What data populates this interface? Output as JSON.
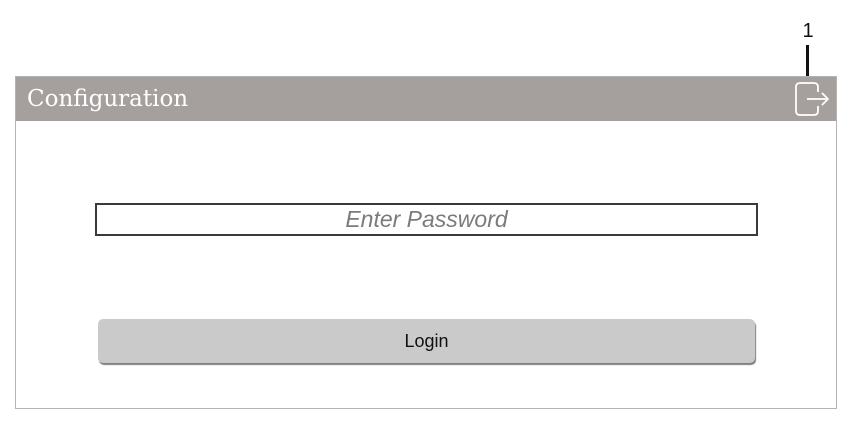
{
  "callout": {
    "number": "1"
  },
  "panel": {
    "title": "Configuration",
    "header_color": "#a5a09e",
    "exit_icon": "logout-icon"
  },
  "password": {
    "value": "",
    "placeholder": "Enter Password"
  },
  "login": {
    "label": "Login"
  }
}
